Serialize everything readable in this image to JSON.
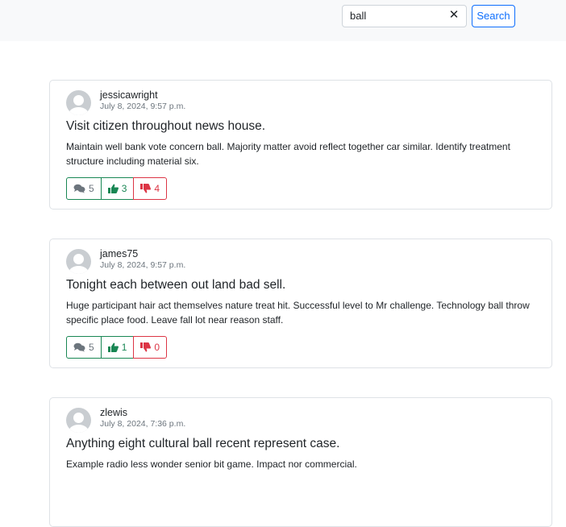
{
  "search": {
    "value": "ball",
    "clear_label": "✕",
    "button_label": "Search"
  },
  "posts": [
    {
      "username": "jessicawright",
      "date": "July 8, 2024, 9:57 p.m.",
      "title": "Visit citizen throughout news house.",
      "body": "Maintain well bank vote concern ball. Majority matter avoid reflect together car similar. Identify treatment structure including material six.",
      "comments": "5",
      "likes": "3",
      "dislikes": "4"
    },
    {
      "username": "james75",
      "date": "July 8, 2024, 9:57 p.m.",
      "title": "Tonight each between out land bad sell.",
      "body": "Huge participant hair act themselves nature treat hit. Successful level to Mr challenge. Technology ball throw specific place food. Leave fall lot near reason staff.",
      "comments": "5",
      "likes": "1",
      "dislikes": "0"
    },
    {
      "username": "zlewis",
      "date": "July 8, 2024, 7:36 p.m.",
      "title": "Anything eight cultural ball recent represent case.",
      "body": "Example radio less wonder senior bit game. Impact nor commercial.",
      "comments": "",
      "likes": "",
      "dislikes": ""
    }
  ],
  "icons": {
    "comments": "comments-icon",
    "likes": "thumbs-up-icon",
    "dislikes": "thumbs-down-icon",
    "avatar": "user-avatar-icon"
  },
  "colors": {
    "like": "#198754",
    "dislike": "#dc3545",
    "primary": "#0d6efd"
  }
}
